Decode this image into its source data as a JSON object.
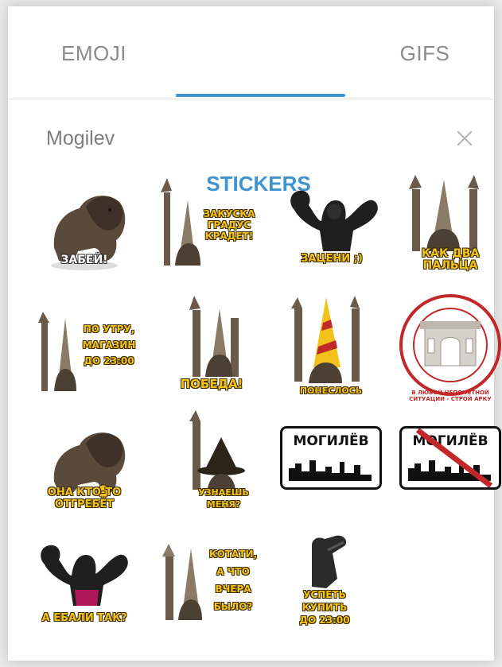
{
  "tabs": {
    "emoji": "EMOJI",
    "stickers": "STICKERS",
    "gifs": "GIFS",
    "active": "STICKERS"
  },
  "sticker_set": {
    "title": "Mogilev",
    "close_icon": "close-icon"
  },
  "stickers": [
    {
      "caption": "ЗАБЕЙ!"
    },
    {
      "caption": "ЗАКУСКА\nГРАДУС\nКРАДЕТ!"
    },
    {
      "caption": "ЗАЦЕНИ ;)"
    },
    {
      "caption": "КАК ДВА\nПАЛЬЦА"
    },
    {
      "caption": "ПО УТРУ,\nМАГАЗИН\nДО 23:00"
    },
    {
      "caption": "ПОБЕДА!"
    },
    {
      "caption": "ПОНЕСЛОСЬ"
    },
    {
      "caption": "В ЛЮБОЙ НЕПОНЯТНОЙ СИТУАЦИИ - СТРОЙ АРКУ"
    },
    {
      "caption": "ОНА КТО-ТО\nОТГРЕБЁТ"
    },
    {
      "caption": "УЗНАЕШЬ\nМЕНЯ?"
    },
    {
      "caption": "МОГИЛЁВ"
    },
    {
      "caption": "МОГИЛЁВ"
    },
    {
      "caption": "А ЕБАЛИ ТАК?"
    },
    {
      "caption": "КОТАТИ,\nА ЧТО\nВЧЕРА\nБЫЛО?"
    },
    {
      "caption": "УСПЕТЬ\nКУПИТЬ\nДО 23:00"
    }
  ],
  "colors": {
    "accent": "#3f93d1",
    "caption": "#f2c21b",
    "stamp": "#c0282a"
  }
}
